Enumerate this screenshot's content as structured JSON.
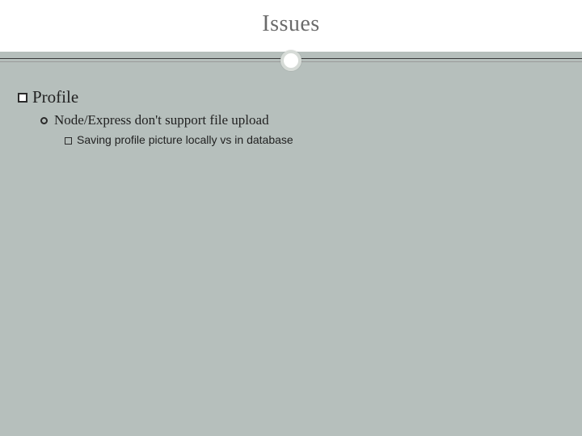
{
  "slide": {
    "title": "Issues",
    "items": [
      {
        "label": "Profile",
        "children": [
          {
            "label": "Node/Express don't support file upload",
            "children": [
              {
                "label": "Saving profile picture locally vs in database"
              }
            ]
          }
        ]
      }
    ]
  }
}
